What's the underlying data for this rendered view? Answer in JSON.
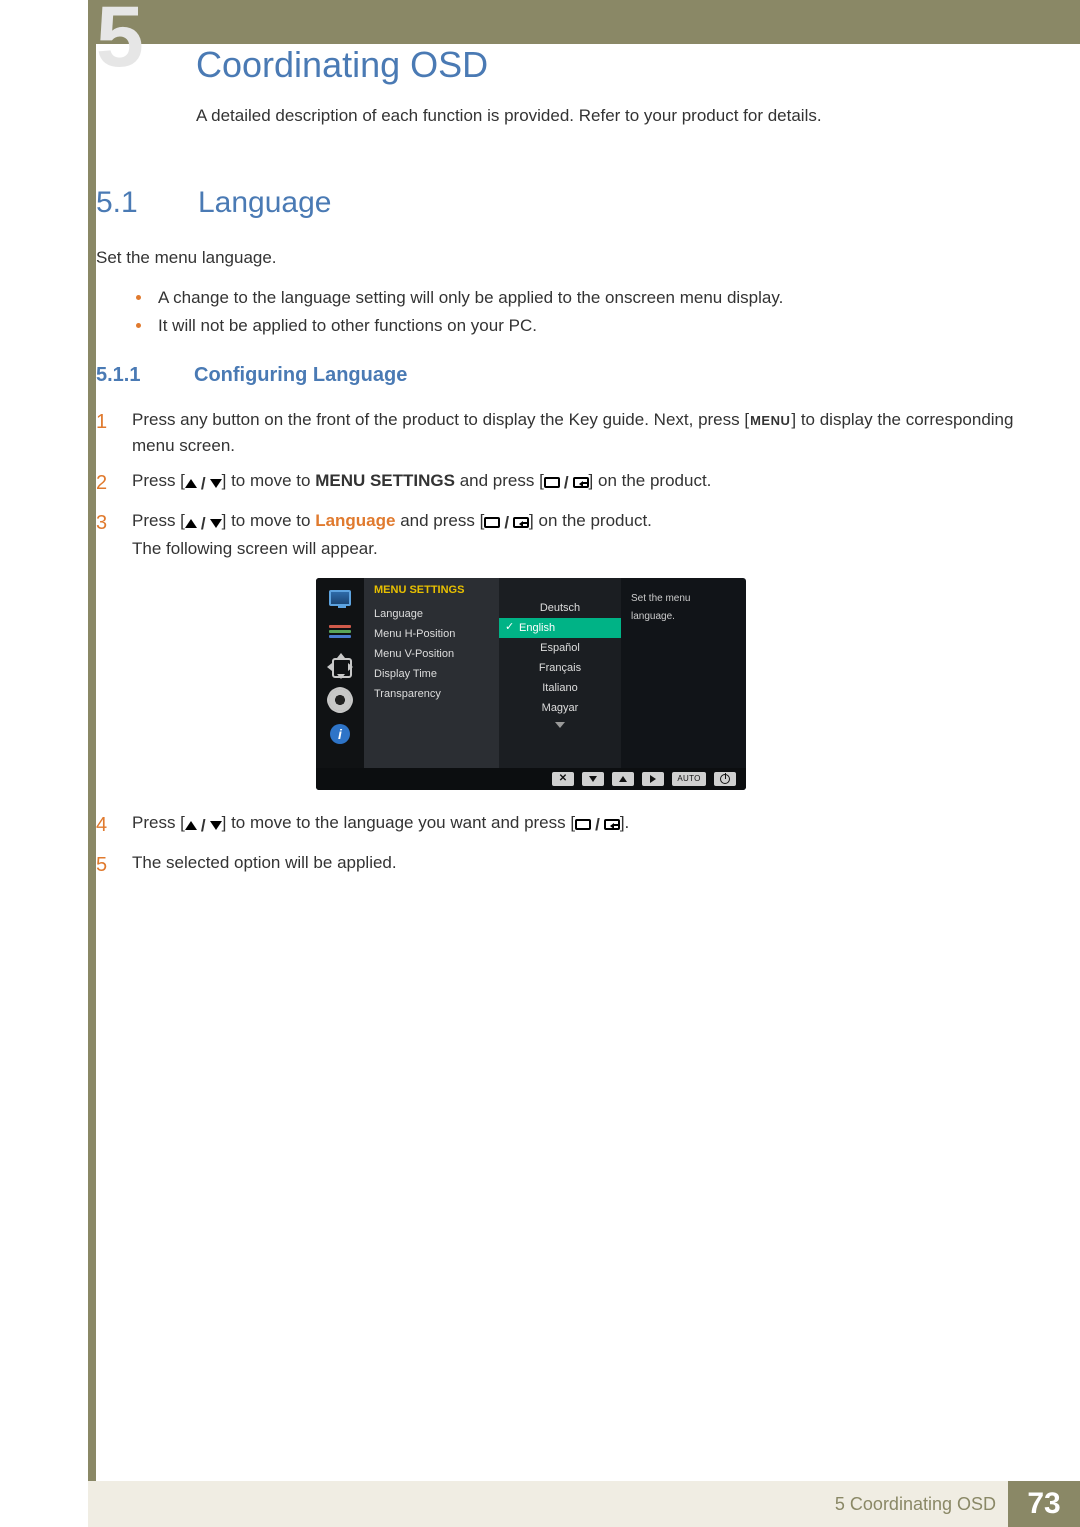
{
  "chapter_badge_number": "5",
  "header": {
    "title": "Coordinating OSD",
    "description": "A detailed description of each function is provided. Refer to your product for details."
  },
  "section": {
    "number": "5.1",
    "name": "Language",
    "intro": "Set the menu language.",
    "notes": [
      "A change to the language setting will only be applied to the onscreen menu display.",
      "It will not be applied to other functions on your PC."
    ]
  },
  "subsection": {
    "number": "5.1.1",
    "name": "Configuring Language"
  },
  "steps": {
    "s1_num": "1",
    "s1_a": "Press any button on the front of the product to display the Key guide. Next, press [",
    "s1_menu": "MENU",
    "s1_b": "] to display the corresponding menu screen.",
    "s2_num": "2",
    "s2_a": "Press [",
    "s2_b": "] to move to ",
    "s2_term": "MENU SETTINGS",
    "s2_c": " and press [",
    "s2_d": "] on the product.",
    "s3_num": "3",
    "s3_a": "Press [",
    "s3_b": "] to move to ",
    "s3_term": "Language",
    "s3_c": " and press [",
    "s3_d": "] on the product.",
    "s3_tail": "The following screen will appear.",
    "s4_num": "4",
    "s4_a": "Press [",
    "s4_b": "] to move to the language you want and press [",
    "s4_c": "].",
    "s5_num": "5",
    "s5_body": "The selected option will be applied."
  },
  "osd": {
    "header": "MENU SETTINGS",
    "menu_items": [
      "Language",
      "Menu H-Position",
      "Menu V-Position",
      "Display Time",
      "Transparency"
    ],
    "languages": [
      "Deutsch",
      "English",
      "Español",
      "Français",
      "Italiano",
      "Magyar"
    ],
    "selected_language_index": 1,
    "help_text": "Set the menu language.",
    "bottom_auto_label": "AUTO"
  },
  "sidebar_icon_names": [
    "osd-picture-icon",
    "osd-color-icon",
    "osd-position-icon",
    "osd-settings-icon",
    "osd-info-icon"
  ],
  "footer": {
    "chapter": "5 Coordinating OSD",
    "page": "73"
  }
}
